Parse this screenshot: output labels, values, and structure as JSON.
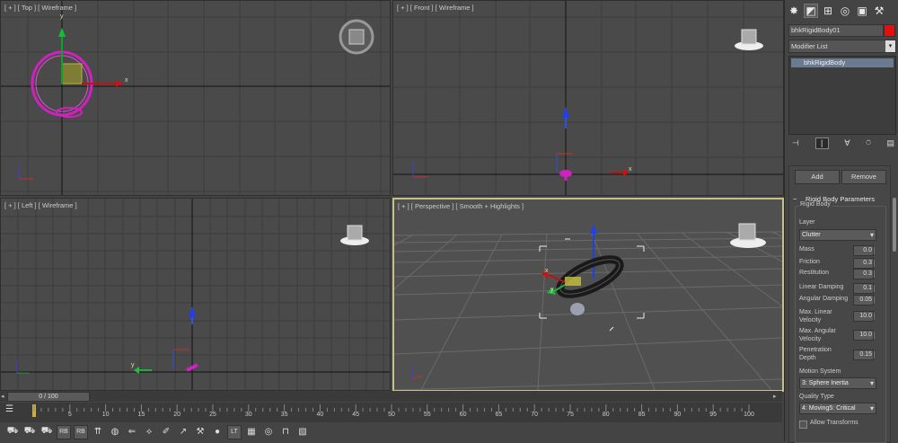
{
  "viewports": {
    "top": {
      "label": "[ + ] [ Top ] [ Wireframe ]",
      "axis_x": "x",
      "axis_y": "y"
    },
    "front": {
      "label": "[ + ] [ Front ] [ Wireframe ]",
      "axis_x": "x"
    },
    "left": {
      "label": "[ + ] [ Left ] [ Wireframe ]",
      "axis_x": "y"
    },
    "perspective": {
      "label": "[ + ] [ Perspective ] [ Smooth + Highlights ]",
      "axis_x": "x",
      "axis_y": "y"
    }
  },
  "command_panel": {
    "tabs": [
      {
        "name": "create-tab",
        "icon": "✸"
      },
      {
        "name": "modify-tab",
        "icon": "◩"
      },
      {
        "name": "hierarchy-tab",
        "icon": "⊞"
      },
      {
        "name": "motion-tab",
        "icon": "◎"
      },
      {
        "name": "display-tab",
        "icon": "▣"
      },
      {
        "name": "utilities-tab",
        "icon": "⚒"
      }
    ],
    "object_name": "bhkRigidBody01",
    "object_color": "#e01010",
    "modifier_list": "Modifier List",
    "stack_items": [
      "bhkRigidBody"
    ],
    "buttons": {
      "add": "Add",
      "remove": "Remove"
    },
    "rollout_title": "Rigid Body Parameters",
    "group_title": "Rigid Body",
    "layer_label": "Layer",
    "layer_value": "Clutter",
    "params": [
      {
        "label": "Mass",
        "value": "0.0"
      },
      {
        "label": "Friction",
        "value": "0.3"
      },
      {
        "label": "Restitution",
        "value": "0.3"
      },
      {
        "label": "Linear Damping",
        "value": "0.1"
      },
      {
        "label": "Angular Damping",
        "value": "0.05"
      },
      {
        "label": "Max. Linear Velocity",
        "value": "10.0"
      },
      {
        "label": "Max. Angular Velocity",
        "value": "10.0"
      },
      {
        "label": "Penetration Depth",
        "value": "0.15"
      }
    ],
    "motion_system_label": "Motion System",
    "motion_system_value": "3: Sphere Inertia",
    "quality_type_label": "Quality Type",
    "quality_type_value": "4: Moving5: Critical",
    "allow_transforms": "Allow Transforms"
  },
  "timeline": {
    "frame_display": "0 / 100",
    "ticks": [
      "0",
      "5",
      "10",
      "15",
      "20",
      "25",
      "30",
      "35",
      "40",
      "45",
      "50",
      "55",
      "60",
      "65",
      "70",
      "75",
      "80",
      "85",
      "90",
      "95",
      "100"
    ]
  },
  "toolbar_icons": [
    "create-selection-icon",
    "object-icon",
    "shape-icon",
    "rb-icon",
    "rb2-icon",
    "rb3-icon",
    "sphere-icon",
    "arrow-left-icon",
    "arrow-diamond-icon",
    "pivot-icon",
    "pen-icon",
    "wrench-icon",
    "dot-icon",
    "lt-icon",
    "grid-icon",
    "globe-icon",
    "lamp-icon",
    "map-icon"
  ]
}
